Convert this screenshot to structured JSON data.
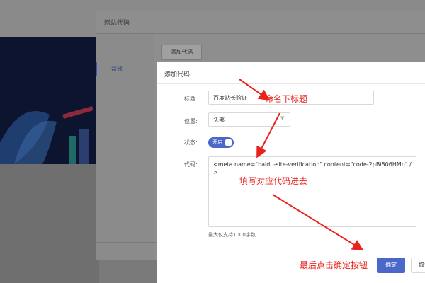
{
  "background": {
    "hero_color": "#0c1430"
  },
  "outer_dialog": {
    "title": "网站代码",
    "sidebar": {
      "items": [
        {
          "label": "常规"
        }
      ]
    },
    "add_button": "添加代码"
  },
  "inner_dialog": {
    "title": "添加代码",
    "form": {
      "title_label": "标题:",
      "title_value": "百度站长验证",
      "position_label": "位置:",
      "position_value": "头部",
      "status_label": "状态:",
      "status_toggle": {
        "label": "开启",
        "on": true
      },
      "code_label": "代码:",
      "code_value": "<meta name=\"baidu-site-verification\" content=\"code-2pBi806HMn\" />",
      "hint": "最大仅支持1000字数"
    },
    "buttons": {
      "confirm": "确定",
      "cancel": "取消"
    }
  },
  "annotations": [
    {
      "text": "命名下标题"
    },
    {
      "text": "填写对应代码进去"
    },
    {
      "text": "最后点击确定按钮"
    }
  ],
  "colors": {
    "accent": "#4a67c9",
    "annotation": "#e8231d"
  }
}
